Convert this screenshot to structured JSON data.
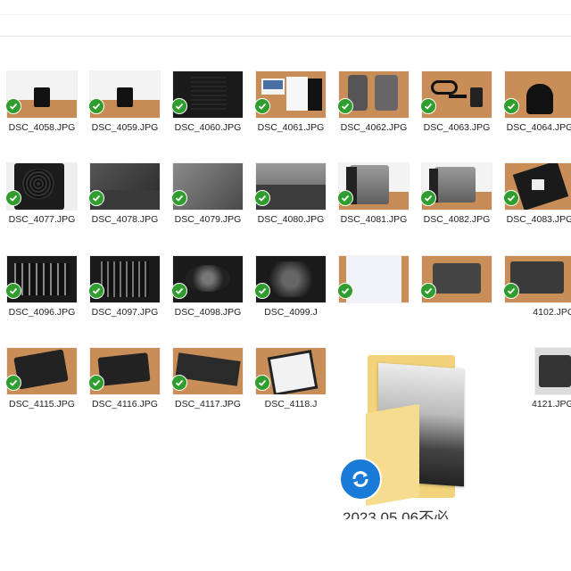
{
  "files": {
    "row1": [
      "DSC_4058.JPG",
      "DSC_4059.JPG",
      "DSC_4060.JPG",
      "DSC_4061.JPG",
      "DSC_4062.JPG",
      "DSC_4063.JPG",
      "DSC_4064.JPG"
    ],
    "row2": [
      "DSC_4077.JPG",
      "DSC_4078.JPG",
      "DSC_4079.JPG",
      "DSC_4080.JPG",
      "DSC_4081.JPG",
      "DSC_4082.JPG",
      "DSC_4083.JPG"
    ],
    "row3": [
      "DSC_4096.JPG",
      "DSC_4097.JPG",
      "DSC_4098.JPG",
      "DSC_4099.J",
      "",
      "",
      "4102.JPG"
    ],
    "row4": [
      "DSC_4115.JPG",
      "DSC_4116.JPG",
      "DSC_4117.JPG",
      "DSC_4118.J",
      "",
      "",
      "4121.JPG"
    ]
  },
  "sync_status": "synced",
  "folder": {
    "label": "2023.05.06不必"
  },
  "colors": {
    "check": "#2f9e2f",
    "sync": "#1a7ad8",
    "folder": "#f2d27a"
  },
  "icons": {
    "check": "check-circle-icon",
    "sync": "sync-icon",
    "folder": "folder-icon"
  }
}
